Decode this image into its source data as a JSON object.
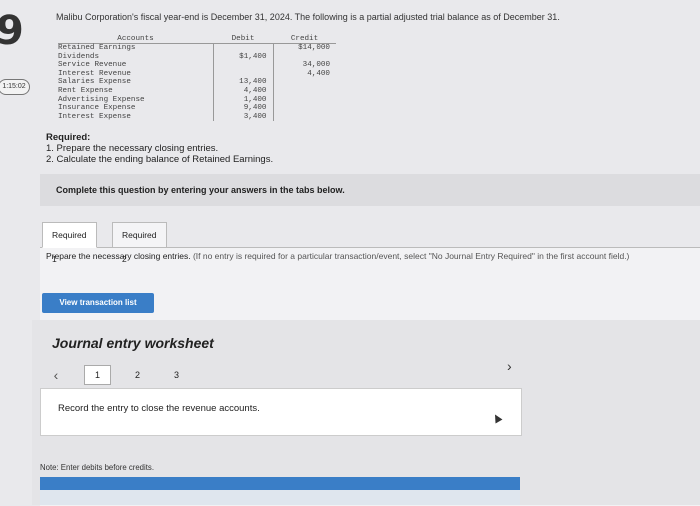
{
  "question_number": "9",
  "timer": "1:15:02",
  "intro_text": "Malibu Corporation's fiscal year-end is December 31, 2024. The following is a partial adjusted trial balance as of December 31.",
  "trial_balance": {
    "headers": [
      "Accounts",
      "Debit",
      "Credit"
    ],
    "rows": [
      {
        "account": "Retained Earnings",
        "debit": "",
        "credit": "$14,000"
      },
      {
        "account": "Dividends",
        "debit": "$1,400",
        "credit": ""
      },
      {
        "account": "Service Revenue",
        "debit": "",
        "credit": "34,000"
      },
      {
        "account": "Interest Revenue",
        "debit": "",
        "credit": "4,400"
      },
      {
        "account": "Salaries Expense",
        "debit": "13,400",
        "credit": ""
      },
      {
        "account": "Rent Expense",
        "debit": "4,400",
        "credit": ""
      },
      {
        "account": "Advertising Expense",
        "debit": "1,400",
        "credit": ""
      },
      {
        "account": "Insurance Expense",
        "debit": "9,400",
        "credit": ""
      },
      {
        "account": "Interest Expense",
        "debit": "3,400",
        "credit": ""
      }
    ]
  },
  "required": {
    "heading": "Required:",
    "items": [
      "1. Prepare the necessary closing entries.",
      "2. Calculate the ending balance of Retained Earnings."
    ]
  },
  "instruction_bar": "Complete this question by entering your answers in the tabs below.",
  "tabs": [
    {
      "label": "Required 1",
      "active": true
    },
    {
      "label": "Required 2",
      "active": false
    }
  ],
  "prepare_text": "Prepare the necessary closing entries.",
  "prepare_note": "(If no entry is required for a particular transaction/event, select \"No Journal Entry Required\" in the first account field.)",
  "view_transaction_button": "View transaction list",
  "worksheet": {
    "title": "Journal entry worksheet",
    "pages": [
      "1",
      "2",
      "3"
    ],
    "active_page": "1",
    "entry_prompt": "Record the entry to close the revenue accounts.",
    "note": "Note: Enter debits before credits."
  },
  "colors": {
    "accent": "#3a7ec7",
    "background": "#e9e9ec"
  }
}
